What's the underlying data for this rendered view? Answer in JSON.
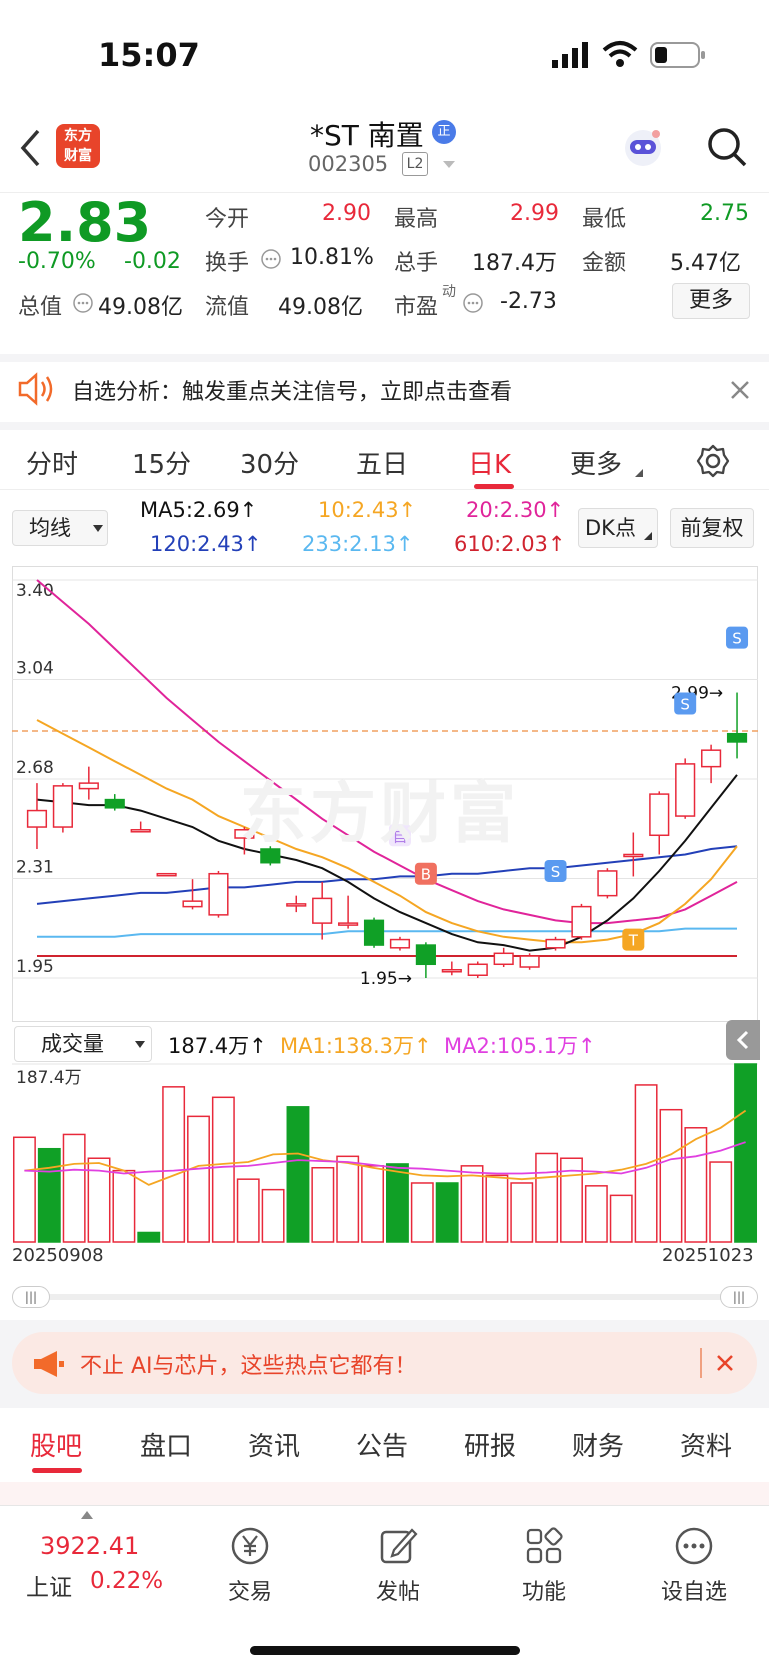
{
  "status_bar": {
    "time": "15:07"
  },
  "header": {
    "logo_text_1": "东方",
    "logo_text_2": "财富",
    "stock_name": "*ST 南置",
    "stock_badge": "正",
    "stock_code": "002305",
    "level": "L2"
  },
  "quote": {
    "price": "2.83",
    "change_pct": "-0.70%",
    "change": "-0.02",
    "open_label": "今开",
    "open": "2.90",
    "high_label": "最高",
    "high": "2.99",
    "low_label": "最低",
    "low": "2.75",
    "turnover_label": "换手",
    "turnover": "10.81%",
    "volume_label": "总手",
    "volume": "187.4万",
    "amount_label": "金额",
    "amount": "5.47亿",
    "mktcap_label": "总值",
    "mktcap": "49.08亿",
    "float_label": "流值",
    "float_cap": "49.08亿",
    "pe_label": "市盈",
    "pe_sup": "动",
    "pe": "-2.73",
    "more_button": "更多"
  },
  "banner1": {
    "text": "自选分析：触发重点关注信号，立即点击查看"
  },
  "tabs": [
    {
      "label": "分时"
    },
    {
      "label": "15分"
    },
    {
      "label": "30分"
    },
    {
      "label": "五日"
    },
    {
      "label": "日K"
    },
    {
      "label": "更多"
    }
  ],
  "ma_bar": {
    "selector": "均线",
    "ma5": "MA5:2.69↑",
    "ma10": "10:2.43↑",
    "ma20": "20:2.30↑",
    "ma120": "120:2.43↑",
    "ma233": "233:2.13↑",
    "ma610": "610:2.03↑",
    "dk_button": "DK点",
    "adjust_button": "前复权"
  },
  "colors": {
    "up": "#e8293a",
    "down": "#10a026",
    "ma5": "#111111",
    "ma10": "#f5a623",
    "ma20": "#e0249a",
    "ma120": "#2340b8",
    "ma233": "#5ab8f0",
    "ma610": "#d0232f"
  },
  "chart_data": [
    {
      "type": "candlestick",
      "y_ticks": [
        "3.40",
        "3.04",
        "2.68",
        "2.31",
        "1.95"
      ],
      "ylim": [
        1.95,
        3.4
      ],
      "annotations": {
        "high_label": "2.99→",
        "low_label": "1.95→"
      },
      "signals": [
        "自",
        "B",
        "S",
        "T",
        "S",
        "S"
      ],
      "candles": [
        {
          "o": 2.5,
          "c": 2.56,
          "h": 2.66,
          "l": 2.42
        },
        {
          "o": 2.5,
          "c": 2.65,
          "h": 2.66,
          "l": 2.48
        },
        {
          "o": 2.64,
          "c": 2.66,
          "h": 2.72,
          "l": 2.6
        },
        {
          "o": 2.6,
          "c": 2.57,
          "h": 2.62,
          "l": 2.56
        },
        {
          "o": 2.49,
          "c": 2.49,
          "h": 2.52,
          "l": 2.49
        },
        {
          "o": 2.33,
          "c": 2.33,
          "h": 2.33,
          "l": 2.33
        },
        {
          "o": 2.21,
          "c": 2.23,
          "h": 2.31,
          "l": 2.2
        },
        {
          "o": 2.18,
          "c": 2.33,
          "h": 2.34,
          "l": 2.17
        },
        {
          "o": 2.46,
          "c": 2.49,
          "h": 2.5,
          "l": 2.4
        },
        {
          "o": 2.42,
          "c": 2.37,
          "h": 2.43,
          "l": 2.36
        },
        {
          "o": 2.22,
          "c": 2.22,
          "h": 2.25,
          "l": 2.19
        },
        {
          "o": 2.15,
          "c": 2.24,
          "h": 2.3,
          "l": 2.09
        },
        {
          "o": 2.15,
          "c": 2.15,
          "h": 2.25,
          "l": 2.13
        },
        {
          "o": 2.16,
          "c": 2.07,
          "h": 2.17,
          "l": 2.06
        },
        {
          "o": 2.06,
          "c": 2.09,
          "h": 2.1,
          "l": 2.05
        },
        {
          "o": 2.07,
          "c": 2.0,
          "h": 2.08,
          "l": 1.95
        },
        {
          "o": 1.98,
          "c": 1.98,
          "h": 2.01,
          "l": 1.96
        },
        {
          "o": 1.96,
          "c": 2.0,
          "h": 2.01,
          "l": 1.95
        },
        {
          "o": 2.0,
          "c": 2.04,
          "h": 2.06,
          "l": 1.99
        },
        {
          "o": 1.99,
          "c": 2.03,
          "h": 2.04,
          "l": 1.98
        },
        {
          "o": 2.06,
          "c": 2.09,
          "h": 2.1,
          "l": 2.05
        },
        {
          "o": 2.1,
          "c": 2.21,
          "h": 2.22,
          "l": 2.09
        },
        {
          "o": 2.25,
          "c": 2.34,
          "h": 2.35,
          "l": 2.24
        },
        {
          "o": 2.4,
          "c": 2.4,
          "h": 2.48,
          "l": 2.32
        },
        {
          "o": 2.47,
          "c": 2.62,
          "h": 2.63,
          "l": 2.4
        },
        {
          "o": 2.54,
          "c": 2.73,
          "h": 2.75,
          "l": 2.53
        },
        {
          "o": 2.72,
          "c": 2.78,
          "h": 2.8,
          "l": 2.66
        },
        {
          "o": 2.84,
          "c": 2.81,
          "h": 2.99,
          "l": 2.75
        }
      ],
      "ma5": [
        2.6,
        2.59,
        2.58,
        2.58,
        2.56,
        2.53,
        2.5,
        2.45,
        2.42,
        2.4,
        2.38,
        2.35,
        2.3,
        2.24,
        2.19,
        2.15,
        2.11,
        2.08,
        2.07,
        2.05,
        2.06,
        2.1,
        2.16,
        2.24,
        2.34,
        2.45,
        2.57,
        2.69
      ],
      "ma10": [
        2.89,
        2.84,
        2.79,
        2.74,
        2.69,
        2.64,
        2.6,
        2.54,
        2.5,
        2.46,
        2.42,
        2.39,
        2.35,
        2.3,
        2.25,
        2.19,
        2.15,
        2.12,
        2.1,
        2.09,
        2.08,
        2.08,
        2.09,
        2.11,
        2.15,
        2.22,
        2.31,
        2.43
      ],
      "ma20": [
        3.4,
        3.32,
        3.24,
        3.15,
        3.06,
        2.97,
        2.89,
        2.81,
        2.74,
        2.67,
        2.6,
        2.53,
        2.47,
        2.41,
        2.36,
        2.31,
        2.27,
        2.23,
        2.2,
        2.18,
        2.16,
        2.15,
        2.15,
        2.16,
        2.17,
        2.2,
        2.25,
        2.3
      ],
      "ma120": [
        2.22,
        2.23,
        2.24,
        2.25,
        2.26,
        2.26,
        2.27,
        2.28,
        2.28,
        2.29,
        2.3,
        2.3,
        2.31,
        2.31,
        2.32,
        2.32,
        2.33,
        2.33,
        2.34,
        2.35,
        2.35,
        2.36,
        2.37,
        2.38,
        2.39,
        2.4,
        2.42,
        2.43
      ],
      "ma233": [
        2.1,
        2.1,
        2.1,
        2.1,
        2.11,
        2.11,
        2.11,
        2.11,
        2.11,
        2.11,
        2.11,
        2.11,
        2.12,
        2.12,
        2.12,
        2.12,
        2.12,
        2.12,
        2.12,
        2.12,
        2.12,
        2.12,
        2.12,
        2.12,
        2.12,
        2.13,
        2.13,
        2.13
      ],
      "ma610": [
        2.03,
        2.03,
        2.03,
        2.03,
        2.03,
        2.03,
        2.03,
        2.03,
        2.03,
        2.03,
        2.03,
        2.03,
        2.03,
        2.03,
        2.03,
        2.03,
        2.03,
        2.03,
        2.03,
        2.03,
        2.03,
        2.03,
        2.03,
        2.03,
        2.03,
        2.03,
        2.03,
        2.03
      ],
      "ref_price": 2.85
    },
    {
      "type": "bar",
      "selector": "成交量",
      "current_volume": "187.4万↑",
      "ma1_label": "MA1:138.3万↑",
      "ma2_label": "MA2:105.1万↑",
      "y_max_label": "187.4万",
      "x_start": "20250908",
      "x_end": "20251023",
      "values": [
        110,
        98,
        113,
        88,
        75,
        10,
        163,
        132,
        152,
        66,
        55,
        142,
        78,
        90,
        80,
        82,
        62,
        62,
        80,
        70,
        62,
        93,
        88,
        59,
        49,
        165,
        139,
        120,
        84,
        187
      ],
      "ma1": [
        75,
        78,
        82,
        83,
        75,
        60,
        70,
        80,
        82,
        84,
        92,
        93,
        86,
        83,
        78,
        74,
        70,
        69,
        70,
        68,
        66,
        68,
        70,
        72,
        76,
        82,
        92,
        108,
        120,
        138
      ],
      "ma2": [
        75,
        74,
        76,
        75,
        72,
        74,
        75,
        77,
        79,
        80,
        83,
        86,
        85,
        84,
        81,
        78,
        77,
        75,
        73,
        72,
        72,
        73,
        75,
        74,
        72,
        78,
        87,
        90,
        96,
        105
      ]
    }
  ],
  "banner2": {
    "text": "不止 AI与芯片，这些热点它都有！"
  },
  "section_tabs": [
    {
      "label": "股吧"
    },
    {
      "label": "盘口"
    },
    {
      "label": "资讯"
    },
    {
      "label": "公告"
    },
    {
      "label": "研报"
    },
    {
      "label": "财务"
    },
    {
      "label": "资料"
    }
  ],
  "bottom_nav": {
    "index_value": "3922.41",
    "index_name": "上证",
    "index_pct": "0.22%",
    "items": [
      {
        "label": "交易"
      },
      {
        "label": "发帖"
      },
      {
        "label": "功能"
      },
      {
        "label": "设自选"
      }
    ]
  }
}
